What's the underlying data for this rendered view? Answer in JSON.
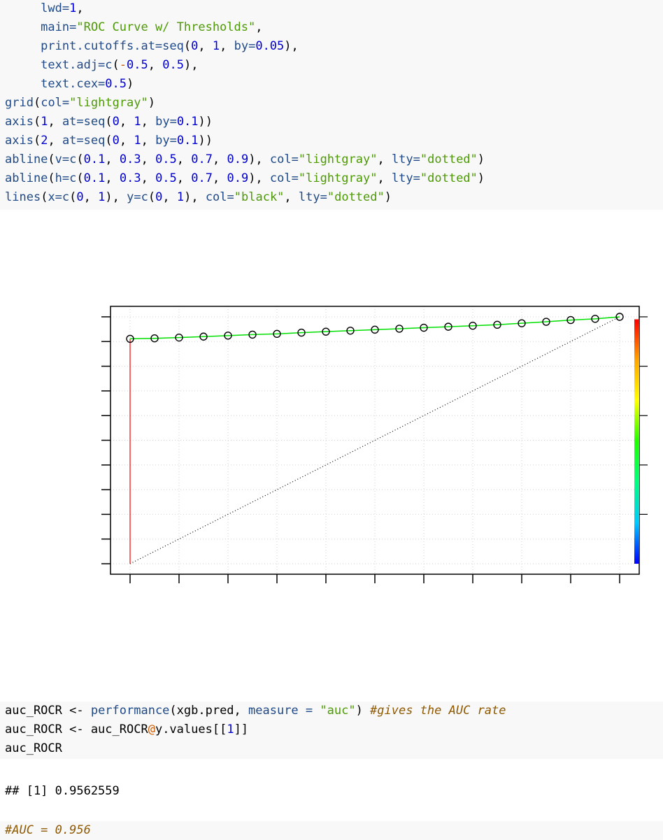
{
  "code_top": {
    "lines": [
      [
        {
          "t": "     lwd=",
          "c": "fn"
        },
        {
          "t": "1",
          "c": "num"
        },
        {
          "t": ",",
          "c": ""
        }
      ],
      [
        {
          "t": "     main=",
          "c": "fn"
        },
        {
          "t": "\"ROC Curve w/ Thresholds\"",
          "c": "str"
        },
        {
          "t": ",",
          "c": ""
        }
      ],
      [
        {
          "t": "     print.cutoffs.at=",
          "c": "fn"
        },
        {
          "t": "seq",
          "c": "fn"
        },
        {
          "t": "(",
          "c": ""
        },
        {
          "t": "0",
          "c": "num"
        },
        {
          "t": ", ",
          "c": ""
        },
        {
          "t": "1",
          "c": "num"
        },
        {
          "t": ", ",
          "c": ""
        },
        {
          "t": "by=",
          "c": "fn"
        },
        {
          "t": "0.05",
          "c": "num"
        },
        {
          "t": "),",
          "c": ""
        }
      ],
      [
        {
          "t": "     text.adj=",
          "c": "fn"
        },
        {
          "t": "c",
          "c": "fn"
        },
        {
          "t": "(",
          "c": ""
        },
        {
          "t": "-",
          "c": "op"
        },
        {
          "t": "0.5",
          "c": "num"
        },
        {
          "t": ", ",
          "c": ""
        },
        {
          "t": "0.5",
          "c": "num"
        },
        {
          "t": "),",
          "c": ""
        }
      ],
      [
        {
          "t": "     text.cex=",
          "c": "fn"
        },
        {
          "t": "0.5",
          "c": "num"
        },
        {
          "t": ")",
          "c": ""
        }
      ],
      [
        {
          "t": "grid",
          "c": "fn"
        },
        {
          "t": "(",
          "c": ""
        },
        {
          "t": "col=",
          "c": "fn"
        },
        {
          "t": "\"lightgray\"",
          "c": "str"
        },
        {
          "t": ")",
          "c": ""
        }
      ],
      [
        {
          "t": "axis",
          "c": "fn"
        },
        {
          "t": "(",
          "c": ""
        },
        {
          "t": "1",
          "c": "num"
        },
        {
          "t": ", ",
          "c": ""
        },
        {
          "t": "at=",
          "c": "fn"
        },
        {
          "t": "seq",
          "c": "fn"
        },
        {
          "t": "(",
          "c": ""
        },
        {
          "t": "0",
          "c": "num"
        },
        {
          "t": ", ",
          "c": ""
        },
        {
          "t": "1",
          "c": "num"
        },
        {
          "t": ", ",
          "c": ""
        },
        {
          "t": "by=",
          "c": "fn"
        },
        {
          "t": "0.1",
          "c": "num"
        },
        {
          "t": "))",
          "c": ""
        }
      ],
      [
        {
          "t": "axis",
          "c": "fn"
        },
        {
          "t": "(",
          "c": ""
        },
        {
          "t": "2",
          "c": "num"
        },
        {
          "t": ", ",
          "c": ""
        },
        {
          "t": "at=",
          "c": "fn"
        },
        {
          "t": "seq",
          "c": "fn"
        },
        {
          "t": "(",
          "c": ""
        },
        {
          "t": "0",
          "c": "num"
        },
        {
          "t": ", ",
          "c": ""
        },
        {
          "t": "1",
          "c": "num"
        },
        {
          "t": ", ",
          "c": ""
        },
        {
          "t": "by=",
          "c": "fn"
        },
        {
          "t": "0.1",
          "c": "num"
        },
        {
          "t": "))",
          "c": ""
        }
      ],
      [
        {
          "t": "abline",
          "c": "fn"
        },
        {
          "t": "(",
          "c": ""
        },
        {
          "t": "v=",
          "c": "fn"
        },
        {
          "t": "c",
          "c": "fn"
        },
        {
          "t": "(",
          "c": ""
        },
        {
          "t": "0.1",
          "c": "num"
        },
        {
          "t": ", ",
          "c": ""
        },
        {
          "t": "0.3",
          "c": "num"
        },
        {
          "t": ", ",
          "c": ""
        },
        {
          "t": "0.5",
          "c": "num"
        },
        {
          "t": ", ",
          "c": ""
        },
        {
          "t": "0.7",
          "c": "num"
        },
        {
          "t": ", ",
          "c": ""
        },
        {
          "t": "0.9",
          "c": "num"
        },
        {
          "t": "), ",
          "c": ""
        },
        {
          "t": "col=",
          "c": "fn"
        },
        {
          "t": "\"lightgray\"",
          "c": "str"
        },
        {
          "t": ", ",
          "c": ""
        },
        {
          "t": "lty=",
          "c": "fn"
        },
        {
          "t": "\"dotted\"",
          "c": "str"
        },
        {
          "t": ")",
          "c": ""
        }
      ],
      [
        {
          "t": "abline",
          "c": "fn"
        },
        {
          "t": "(",
          "c": ""
        },
        {
          "t": "h=",
          "c": "fn"
        },
        {
          "t": "c",
          "c": "fn"
        },
        {
          "t": "(",
          "c": ""
        },
        {
          "t": "0.1",
          "c": "num"
        },
        {
          "t": ", ",
          "c": ""
        },
        {
          "t": "0.3",
          "c": "num"
        },
        {
          "t": ", ",
          "c": ""
        },
        {
          "t": "0.5",
          "c": "num"
        },
        {
          "t": ", ",
          "c": ""
        },
        {
          "t": "0.7",
          "c": "num"
        },
        {
          "t": ", ",
          "c": ""
        },
        {
          "t": "0.9",
          "c": "num"
        },
        {
          "t": "), ",
          "c": ""
        },
        {
          "t": "col=",
          "c": "fn"
        },
        {
          "t": "\"lightgray\"",
          "c": "str"
        },
        {
          "t": ", ",
          "c": ""
        },
        {
          "t": "lty=",
          "c": "fn"
        },
        {
          "t": "\"dotted\"",
          "c": "str"
        },
        {
          "t": ")",
          "c": ""
        }
      ],
      [
        {
          "t": "lines",
          "c": "fn"
        },
        {
          "t": "(",
          "c": ""
        },
        {
          "t": "x=",
          "c": "fn"
        },
        {
          "t": "c",
          "c": "fn"
        },
        {
          "t": "(",
          "c": ""
        },
        {
          "t": "0",
          "c": "num"
        },
        {
          "t": ", ",
          "c": ""
        },
        {
          "t": "1",
          "c": "num"
        },
        {
          "t": "), ",
          "c": ""
        },
        {
          "t": "y=",
          "c": "fn"
        },
        {
          "t": "c",
          "c": "fn"
        },
        {
          "t": "(",
          "c": ""
        },
        {
          "t": "0",
          "c": "num"
        },
        {
          "t": ", ",
          "c": ""
        },
        {
          "t": "1",
          "c": "num"
        },
        {
          "t": "), ",
          "c": ""
        },
        {
          "t": "col=",
          "c": "fn"
        },
        {
          "t": "\"black\"",
          "c": "str"
        },
        {
          "t": ", ",
          "c": ""
        },
        {
          "t": "lty=",
          "c": "fn"
        },
        {
          "t": "\"dotted\"",
          "c": "str"
        },
        {
          "t": ")",
          "c": ""
        }
      ]
    ]
  },
  "code_auc": {
    "lines": [
      [
        {
          "t": "auc_ROCR <- ",
          "c": ""
        },
        {
          "t": "performance",
          "c": "fn"
        },
        {
          "t": "(xgb.pred, ",
          "c": ""
        },
        {
          "t": "measure = ",
          "c": "fn"
        },
        {
          "t": "\"auc\"",
          "c": "str"
        },
        {
          "t": ") ",
          "c": ""
        },
        {
          "t": "#gives the AUC rate",
          "c": "cm"
        }
      ],
      [
        {
          "t": "auc_ROCR <- auc_ROCR",
          "c": ""
        },
        {
          "t": "@",
          "c": "op"
        },
        {
          "t": "y.values[[",
          "c": ""
        },
        {
          "t": "1",
          "c": "num"
        },
        {
          "t": "]]",
          "c": ""
        }
      ],
      [
        {
          "t": "auc_ROCR",
          "c": ""
        }
      ]
    ]
  },
  "output": {
    "auc_line": "## [1] 0.9562559"
  },
  "code_comment": {
    "lines": [
      [
        {
          "t": "#AUC = 0.956",
          "c": "cm"
        }
      ]
    ]
  },
  "chart_data": {
    "type": "line",
    "x_ticks": [
      0,
      0.1,
      0.2,
      0.3,
      0.4,
      0.5,
      0.6,
      0.7,
      0.8,
      0.9,
      1.0
    ],
    "y_ticks": [
      0,
      0.1,
      0.2,
      0.3,
      0.4,
      0.5,
      0.6,
      0.7,
      0.8,
      0.9,
      1.0
    ],
    "xlim": [
      0,
      1
    ],
    "ylim": [
      0,
      1
    ],
    "grid": true,
    "roc_vertical": {
      "x": [
        0,
        0
      ],
      "y": [
        0,
        0.911
      ],
      "color": "#ff0000"
    },
    "roc_curve": {
      "x": [
        0,
        1
      ],
      "y": [
        0.911,
        1.0
      ],
      "color": "#00e000"
    },
    "cutoff_markers": {
      "x": [
        0,
        0.05,
        0.1,
        0.15,
        0.2,
        0.25,
        0.3,
        0.35,
        0.4,
        0.45,
        0.5,
        0.55,
        0.6,
        0.65,
        0.7,
        0.75,
        0.8,
        0.85,
        0.9,
        0.95,
        1.0
      ],
      "y": [
        0.911,
        0.913,
        0.916,
        0.92,
        0.924,
        0.928,
        0.931,
        0.936,
        0.94,
        0.944,
        0.948,
        0.952,
        0.956,
        0.96,
        0.964,
        0.968,
        0.974,
        0.98,
        0.987,
        0.992,
        1.0
      ]
    },
    "diagonal": {
      "x": [
        0,
        1
      ],
      "y": [
        0,
        1
      ],
      "color": "#000000",
      "style": "dotted"
    },
    "colorbar": {
      "colors": [
        "#0000ff",
        "#00c8ff",
        "#00ff80",
        "#20ff00",
        "#ffff00",
        "#ffa500",
        "#ff0000"
      ],
      "placement": "right"
    }
  }
}
